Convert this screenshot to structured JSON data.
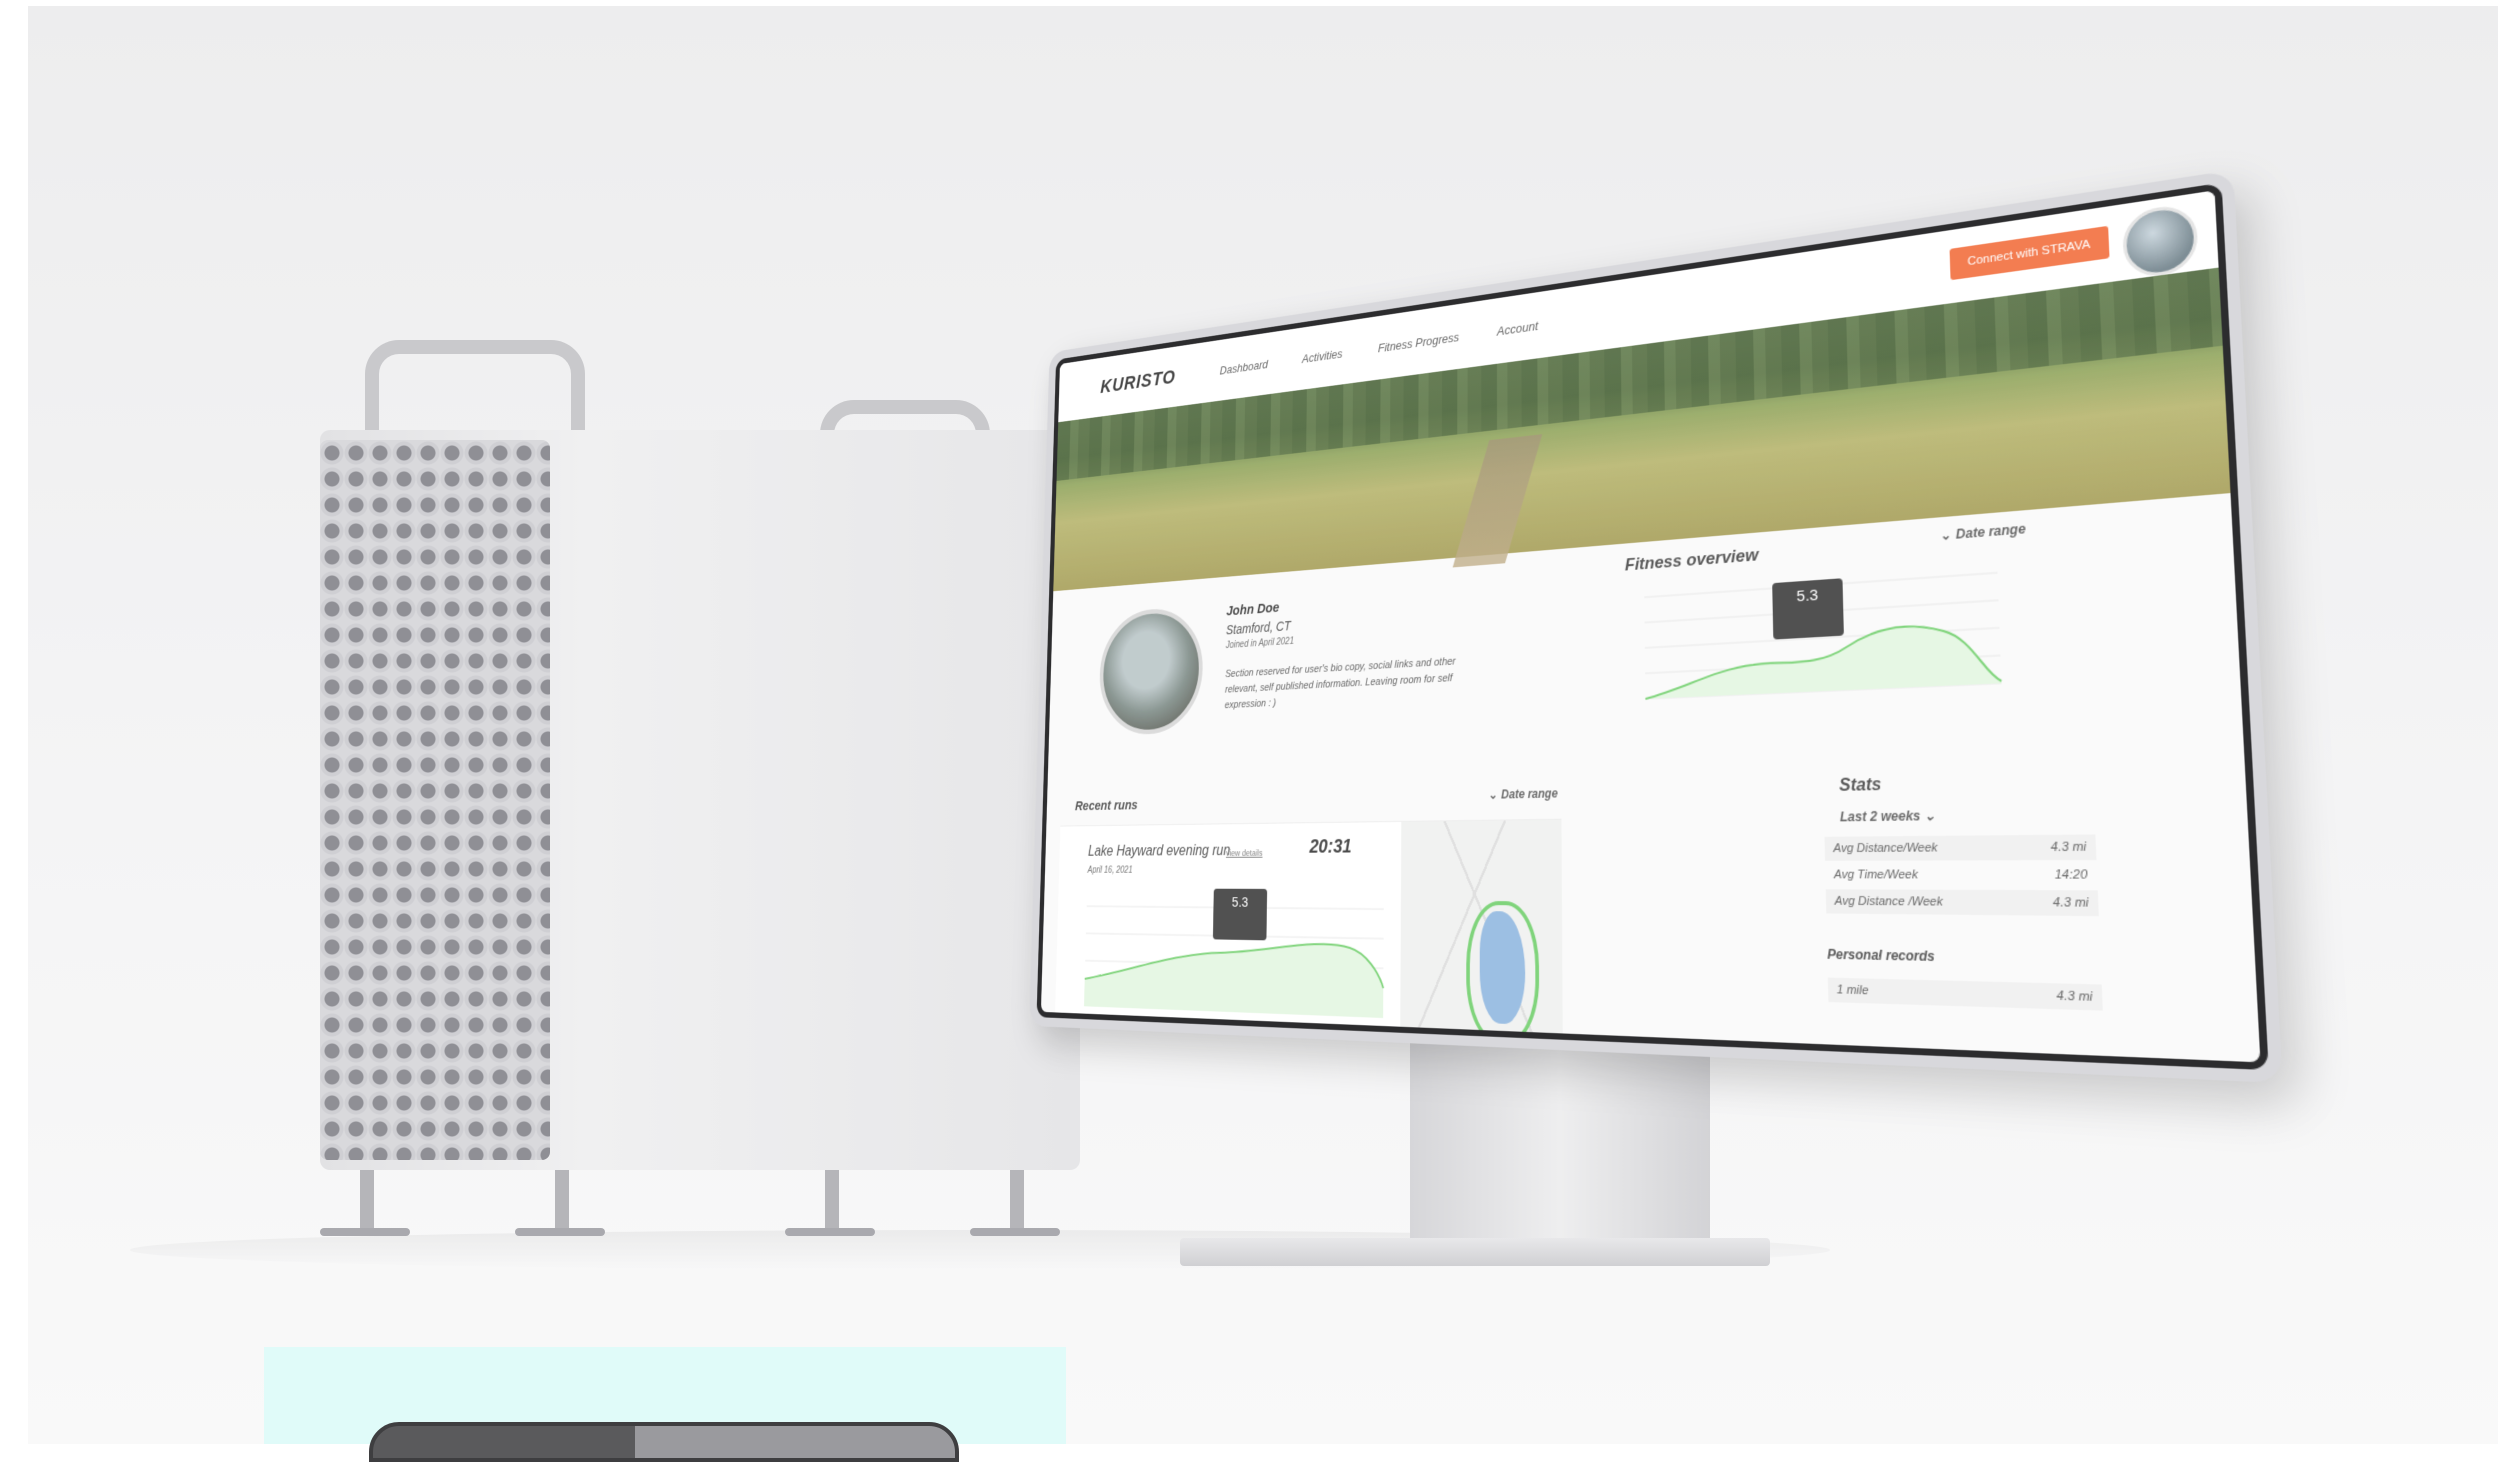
{
  "app": {
    "logo": "KURISTO",
    "nav": [
      "Dashboard",
      "Activities",
      "Fitness Progress",
      "Account"
    ],
    "connect_button": "Connect with STRAVA"
  },
  "profile": {
    "name": "John Doe",
    "location": "Stamford, CT",
    "joined": "Joined in April 2021",
    "bio": "Section reserved for user's bio copy, social links and other relevant, self published information. Leaving room for self expression : )"
  },
  "fitness_overview": {
    "title": "Fitness overview",
    "date_range_label": "Date range",
    "tooltip_value": "5.3"
  },
  "recent_runs": {
    "title": "Recent runs",
    "date_range_label": "Date range",
    "run": {
      "name": "Lake Hayward evening run",
      "link": "view details",
      "time": "20:31",
      "date": "April 16, 2021",
      "tooltip_value": "5.3"
    }
  },
  "stats": {
    "title": "Stats",
    "period": "Last 2 weeks",
    "rows": [
      {
        "label": "Avg Distance/Week",
        "value": "4.3 mi"
      },
      {
        "label": "Avg Time/Week",
        "value": "14:20"
      },
      {
        "label": "Avg Distance /Week",
        "value": "4.3 mi"
      }
    ],
    "personal_records_title": "Personal records",
    "personal_records": [
      {
        "label": "1 mile",
        "value": "4.3 mi"
      }
    ]
  },
  "colors": {
    "accent": "#f26b3a",
    "chart_line": "#6fcf6a",
    "chart_fill": "#e3f6e1"
  },
  "icons": {
    "chevron": "chevron-down-icon"
  }
}
